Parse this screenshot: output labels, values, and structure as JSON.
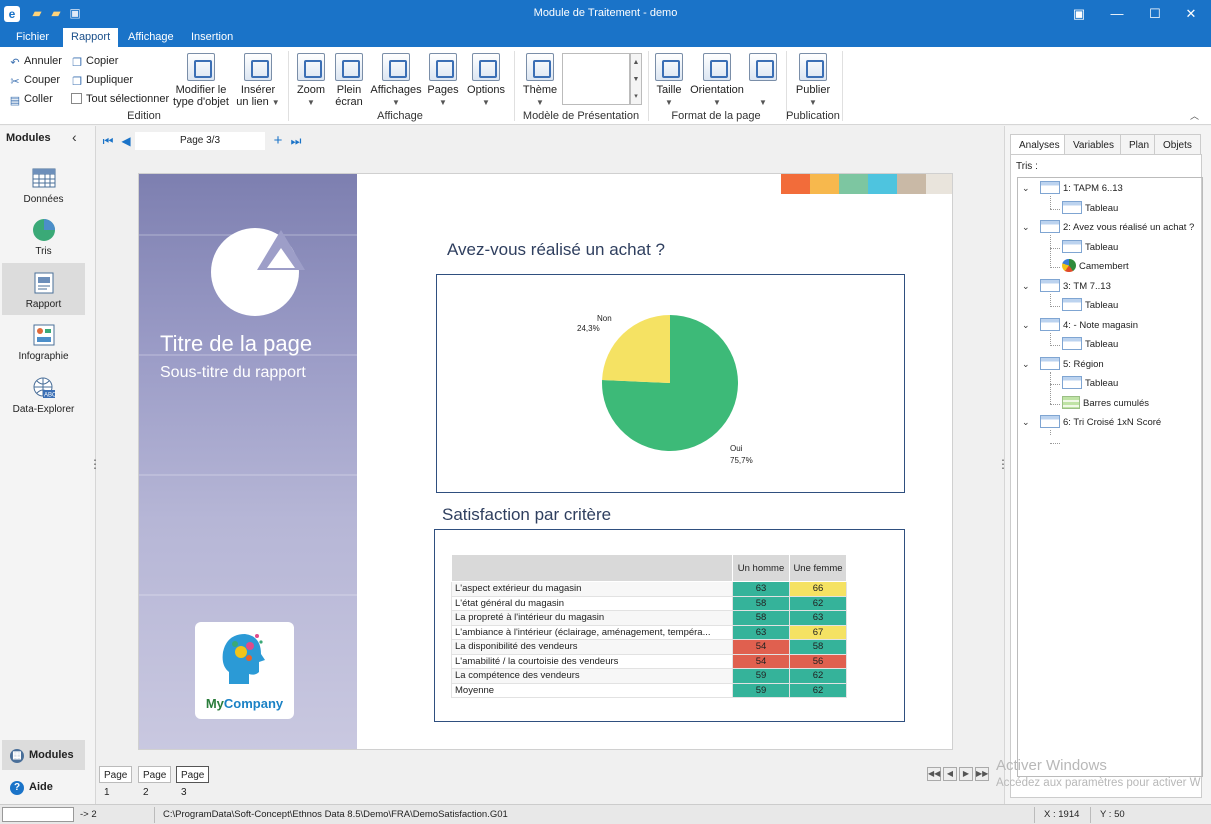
{
  "window": {
    "title": "Module de Traitement - demo"
  },
  "tabs": [
    {
      "label": "Fichier",
      "active": false
    },
    {
      "label": "Rapport",
      "active": true
    },
    {
      "label": "Affichage",
      "active": false
    },
    {
      "label": "Insertion",
      "active": false
    }
  ],
  "ribbon": {
    "edition": {
      "undo": "Annuler",
      "cut": "Couper",
      "paste": "Coller",
      "copy": "Copier",
      "duplicate": "Dupliquer",
      "select_all": "Tout sélectionner",
      "label": "Edition"
    },
    "modify_type": [
      "Modifier le",
      "type d'objet"
    ],
    "insert_link": [
      "Insérer",
      "un lien"
    ],
    "affichage": {
      "zoom": "Zoom",
      "fullscreen": [
        "Plein",
        "écran"
      ],
      "affichages": "Affichages",
      "pages": "Pages",
      "options": "Options",
      "label": "Affichage"
    },
    "modele": {
      "theme": "Thème",
      "label": "Modèle de Présentation"
    },
    "format": {
      "size": "Taille",
      "orientation": "Orientation",
      "label": "Format de la page"
    },
    "publication": {
      "publish": "Publier",
      "label": "Publication"
    }
  },
  "modules": {
    "header": "Modules",
    "items": [
      {
        "label": "Données",
        "active": false
      },
      {
        "label": "Tris",
        "active": false
      },
      {
        "label": "Rapport",
        "active": true
      },
      {
        "label": "Infographie",
        "active": false
      },
      {
        "label": "Data-Explorer",
        "active": false
      }
    ],
    "bottom_modules": "Modules",
    "bottom_help": "Aide"
  },
  "pagenav": {
    "current": "Page 3/3"
  },
  "cover": {
    "title": "Titre de la page",
    "subtitle": "Sous-titre du rapport",
    "brand_a": "My",
    "brand_b": "Company"
  },
  "palette": [
    "#f26c3a",
    "#f7b84d",
    "#7dc6a1",
    "#4ec4df",
    "#c9b9a6",
    "#e9e4dc"
  ],
  "section1_title": "Avez-vous réalisé un achat ?",
  "section2_title": "Satisfaction par critère",
  "chart_data": {
    "type": "pie",
    "slices": [
      {
        "label": "Oui",
        "value": 75.7,
        "display": "75,7%",
        "color": "#3dba78"
      },
      {
        "label": "Non",
        "value": 24.3,
        "display": "24,3%",
        "color": "#f5e263"
      }
    ]
  },
  "table": {
    "headers": [
      "",
      "Un homme",
      "Une femme"
    ],
    "rows": [
      {
        "label": "L'aspect extérieur du magasin",
        "h": 63,
        "f": 66,
        "hc": "#35b39a",
        "fc": "#f5e263"
      },
      {
        "label": "L'état général du magasin",
        "h": 58,
        "f": 62,
        "hc": "#35b39a",
        "fc": "#35b39a"
      },
      {
        "label": "La propreté à l'intérieur du magasin",
        "h": 58,
        "f": 63,
        "hc": "#35b39a",
        "fc": "#35b39a"
      },
      {
        "label": "L'ambiance à l'intérieur (éclairage, aménagement, tempéra...",
        "h": 63,
        "f": 67,
        "hc": "#35b39a",
        "fc": "#f5e263"
      },
      {
        "label": "La disponibilité des vendeurs",
        "h": 54,
        "f": 58,
        "hc": "#e0604f",
        "fc": "#35b39a"
      },
      {
        "label": "L'amabilité / la courtoisie des vendeurs",
        "h": 54,
        "f": 56,
        "hc": "#e0604f",
        "fc": "#e0604f"
      },
      {
        "label": "La compétence des vendeurs",
        "h": 59,
        "f": 62,
        "hc": "#35b39a",
        "fc": "#35b39a"
      },
      {
        "label": "Moyenne",
        "h": 59,
        "f": 62,
        "hc": "#35b39a",
        "fc": "#35b39a"
      }
    ]
  },
  "page_tabs": [
    "Page 1",
    "Page 2",
    "Page 3"
  ],
  "right_panel": {
    "tabs": [
      {
        "label": "Analyses",
        "active": true
      },
      {
        "label": "Variables",
        "active": false
      },
      {
        "label": "Plan",
        "active": false
      },
      {
        "label": "Objets",
        "active": false
      }
    ],
    "tris_label": "Tris :",
    "tree": [
      {
        "label": "1: TAPM 6..13",
        "children": [
          {
            "label": "Tableau",
            "icon": "table"
          }
        ]
      },
      {
        "label": "2: Avez vous réalisé un achat ?",
        "children": [
          {
            "label": "Tableau",
            "icon": "table"
          },
          {
            "label": "Camembert",
            "icon": "pie"
          }
        ]
      },
      {
        "label": "3: TM 7..13",
        "children": [
          {
            "label": "Tableau",
            "icon": "table"
          }
        ]
      },
      {
        "label": "4: - Note magasin",
        "children": [
          {
            "label": "Tableau",
            "icon": "table"
          }
        ]
      },
      {
        "label": "5: Région",
        "children": [
          {
            "label": "Tableau",
            "icon": "table"
          },
          {
            "label": "Barres cumulés",
            "icon": "bars"
          }
        ]
      },
      {
        "label": "6: Tri Croisé 1xN Scoré",
        "children": []
      }
    ]
  },
  "watermark": {
    "line1": "Activer Windows",
    "line2": "Accédez aux paramètres pour activer W"
  },
  "status": {
    "arrow": "-> 2",
    "path": "C:\\ProgramData\\Soft-Concept\\Ethnos Data 8.5\\Demo\\FRA\\DemoSatisfaction.G01",
    "x": "X : 1914",
    "y": "Y : 50"
  }
}
